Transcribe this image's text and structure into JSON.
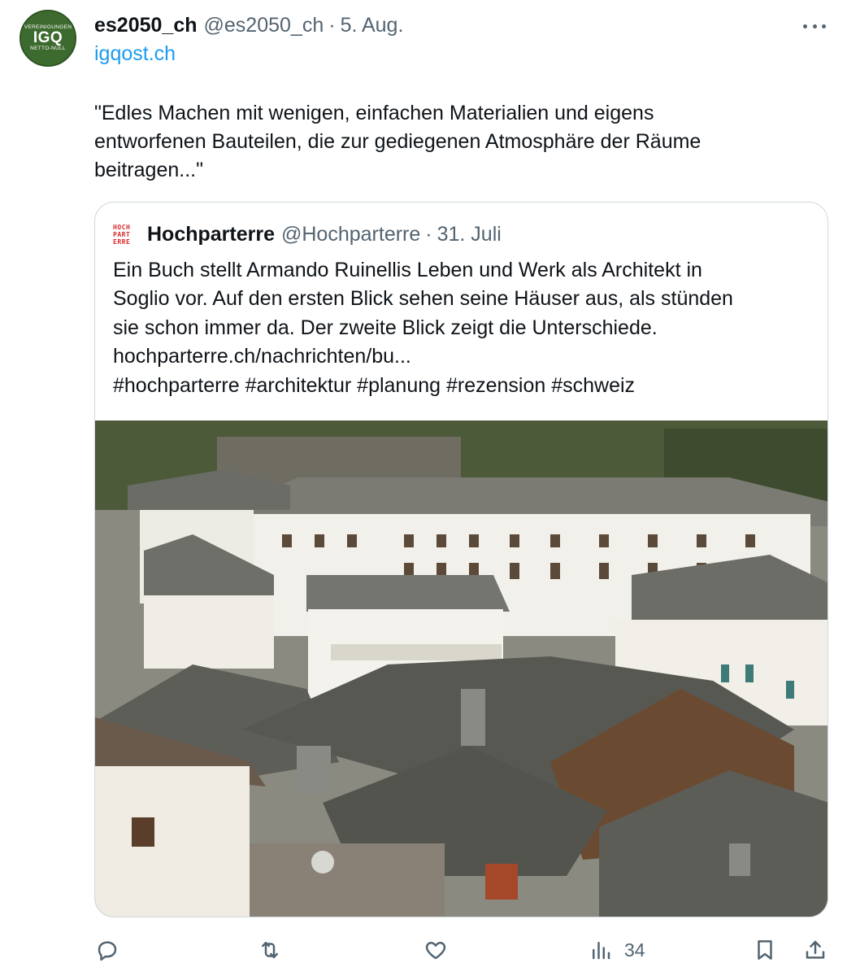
{
  "author": {
    "avatar_top": "VEREINIGUNGEN",
    "avatar_mid": "IGQ",
    "avatar_bot": "NETTO-NULL",
    "display_name": "es2050_ch",
    "handle": "@es2050_ch",
    "separator": "·",
    "date": "5. Aug.",
    "link": "igqost.ch"
  },
  "tweet_text": "\"Edles Machen mit wenigen, einfachen Materialien und eigens\nentworfenen Bauteilen, die zur gediegenen Atmosphäre der Räume\nbeitragen...\"",
  "quoted": {
    "logo_lines": [
      "HOCH",
      "PART",
      "ERRE"
    ],
    "display_name": "Hochparterre",
    "handle": "@Hochparterre",
    "separator": "·",
    "date": "31. Juli",
    "lines": [
      "Ein Buch stellt Armando Ruinellis Leben und Werk als Architekt in",
      "Soglio vor. Auf den ersten Blick sehen seine Häuser aus, als stünden",
      "sie schon immer da. Der zweite Blick zeigt die Unterschiede.",
      "hochparterre.ch/nachrichten/bu...",
      "#hochparterre #architektur #planung #rezension #schweiz"
    ]
  },
  "actions": {
    "reply_icon": "reply-icon",
    "retweet_icon": "retweet-icon",
    "like_icon": "like-icon",
    "views_icon": "views-icon",
    "views_count": "34",
    "bookmark_icon": "bookmark-icon",
    "share_icon": "share-icon"
  },
  "colors": {
    "link": "#1d9bf0",
    "secondary": "#536471",
    "avatar_bg": "#3d6a2e",
    "logo_red": "#d92b2b"
  }
}
